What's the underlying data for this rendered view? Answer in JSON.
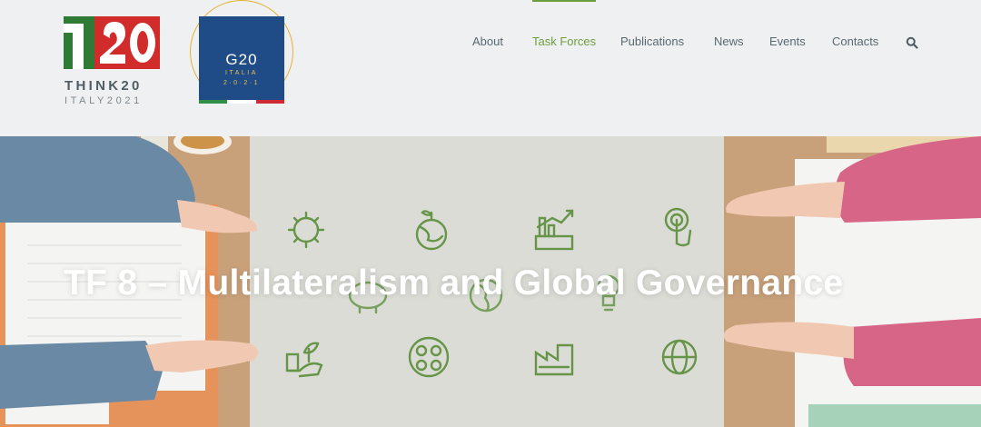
{
  "logos": {
    "t20": {
      "mark": "T20",
      "word": "THINK20",
      "sub": "ITALY2021"
    },
    "g20": {
      "title": "G20",
      "line1": "ITALIA",
      "line2": "2·0·2·1"
    }
  },
  "nav": {
    "items": [
      {
        "label": "About",
        "active": false
      },
      {
        "label": "Task Forces",
        "active": true
      },
      {
        "label": "Publications",
        "active": false
      },
      {
        "label": "News",
        "active": false
      },
      {
        "label": "Events",
        "active": false
      },
      {
        "label": "Contacts",
        "active": false
      }
    ],
    "search_icon": "search-icon"
  },
  "hero": {
    "title": "TF 8 – Multilateralism and Global Governance",
    "icons": [
      "virus-icon",
      "globe-plant-icon",
      "economy-chart-icon",
      "touch-icon",
      "piggy-bank-icon",
      "africa-globe-icon",
      "lightbulb-icon",
      "hand-plant-icon",
      "people-circle-icon",
      "factory-icon",
      "globe-icon"
    ]
  },
  "colors": {
    "accent": "#6d9e3e",
    "nav_text": "#5a6870",
    "t20_green": "#2f7a34",
    "t20_red": "#d12b2b",
    "g20_blue": "#1f4b87",
    "g20_gold": "#e5b130",
    "icon_green": "#5a8d3a"
  }
}
